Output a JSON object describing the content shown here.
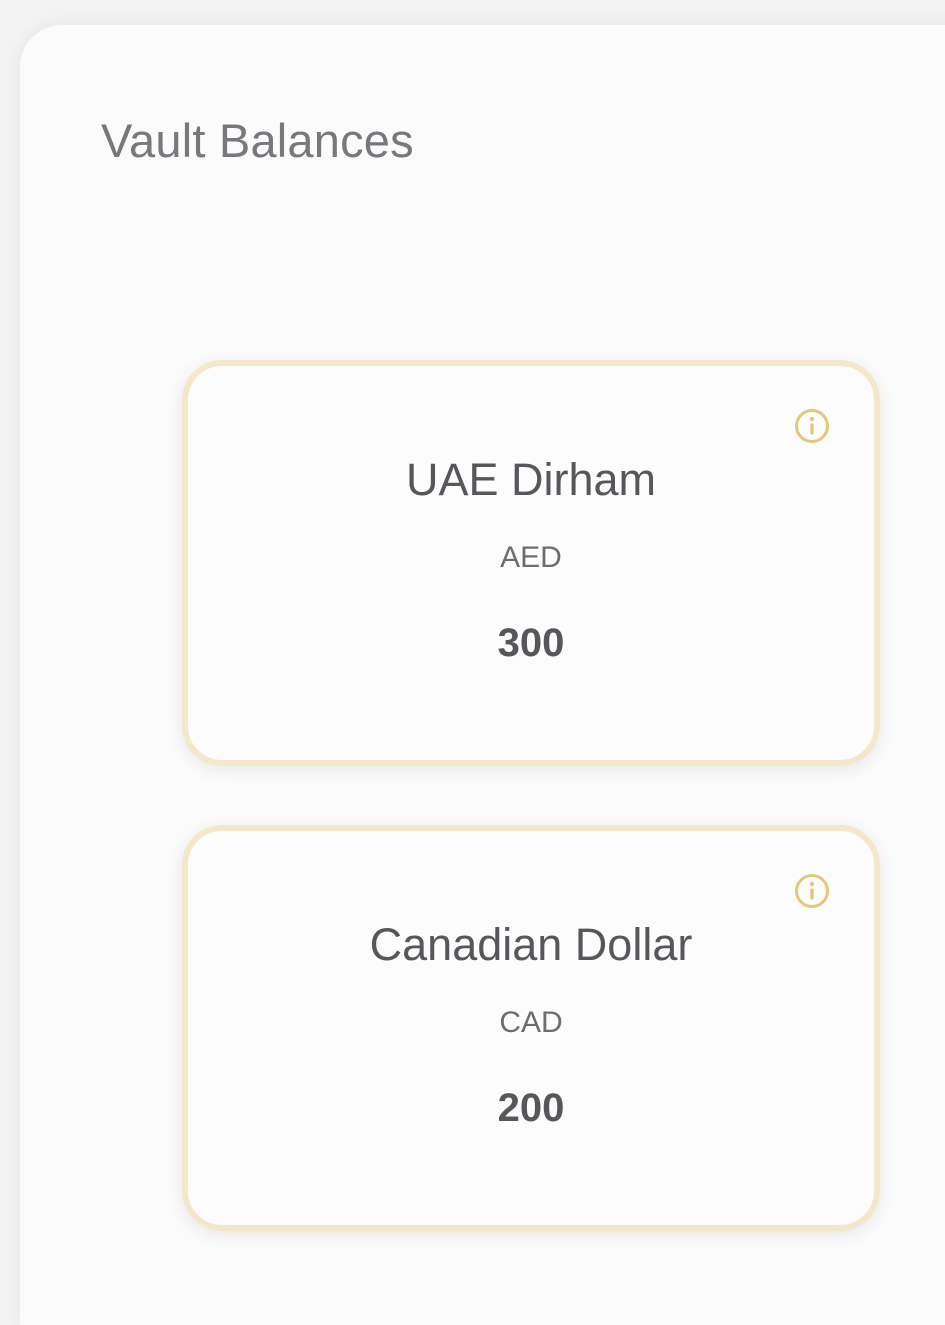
{
  "page": {
    "title": "Vault Balances"
  },
  "balances": [
    {
      "name": "UAE Dirham",
      "code": "AED",
      "amount": "300",
      "icon": "info-icon"
    },
    {
      "name": "Canadian Dollar",
      "code": "CAD",
      "amount": "200",
      "icon": "info-icon"
    }
  ],
  "colors": {
    "accent": "#e2c97a",
    "card_border": "#f3e8c9",
    "text_primary": "#56575b",
    "text_muted": "#77777c",
    "background": "#fbfbfb"
  }
}
